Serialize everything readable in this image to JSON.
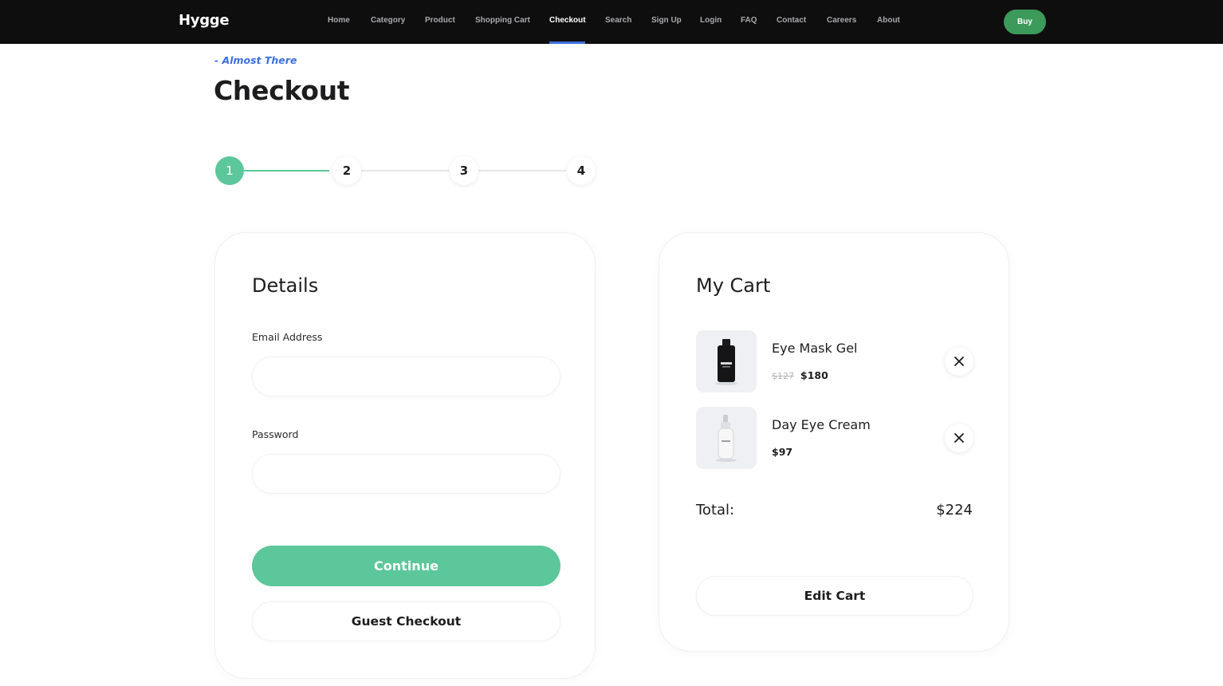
{
  "brand": {
    "logo": "Hygge"
  },
  "nav": {
    "items": [
      {
        "label": "Home"
      },
      {
        "label": "Category"
      },
      {
        "label": "Product"
      },
      {
        "label": "Shopping Cart"
      },
      {
        "label": "Checkout",
        "active": true
      },
      {
        "label": "Search"
      },
      {
        "label": "Sign Up"
      },
      {
        "label": "Login"
      },
      {
        "label": "FAQ"
      },
      {
        "label": "Contact"
      },
      {
        "label": "Careers"
      },
      {
        "label": "About"
      }
    ],
    "buy_label": "Buy"
  },
  "header": {
    "eyebrow": "- Almost There",
    "title": "Checkout"
  },
  "stepper": {
    "steps": [
      "1",
      "2",
      "3",
      "4"
    ],
    "current_step": 1
  },
  "details": {
    "title": "Details",
    "email_label": "Email Address",
    "email_value": "",
    "password_label": "Password",
    "password_value": "",
    "continue_label": "Continue",
    "guest_label": "Guest Checkout"
  },
  "cart": {
    "title": "My Cart",
    "items": [
      {
        "name": "Eye Mask Gel",
        "old_price": "$127",
        "price": "$180",
        "image_icon": "dark-bottle-icon"
      },
      {
        "name": "Day Eye Cream",
        "old_price": "",
        "price": "$97",
        "image_icon": "white-bottle-icon"
      }
    ],
    "total_label": "Total:",
    "total_value": "$224",
    "edit_label": "Edit Cart"
  },
  "colors": {
    "accent_green": "#5cc79a",
    "buy_green": "#3c9a5a",
    "link_blue": "#3d6fe0",
    "nav_bg": "#0e0e0f"
  }
}
